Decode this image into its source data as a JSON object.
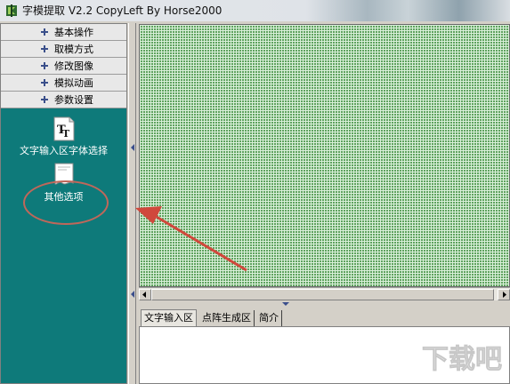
{
  "window": {
    "title": "字模提取 V2.2  CopyLeft By Horse2000"
  },
  "sidebar": {
    "menu": [
      {
        "label": "基本操作"
      },
      {
        "label": "取模方式"
      },
      {
        "label": "修改图像"
      },
      {
        "label": "模拟动画"
      },
      {
        "label": "参数设置"
      }
    ],
    "tools": [
      {
        "label": "文字输入区字体选择",
        "icon": "font-tt-icon"
      },
      {
        "label": "其他选项",
        "icon": "document-icon"
      }
    ]
  },
  "tabs": [
    {
      "label": "文字输入区"
    },
    {
      "label": "点阵生成区"
    },
    {
      "label": "简介"
    }
  ],
  "watermark": {
    "text": "下载吧"
  },
  "colors": {
    "sidebar_bg": "#0e7a7a",
    "grid_green": "#5fa25f",
    "annotation_red": "#d0483c"
  }
}
